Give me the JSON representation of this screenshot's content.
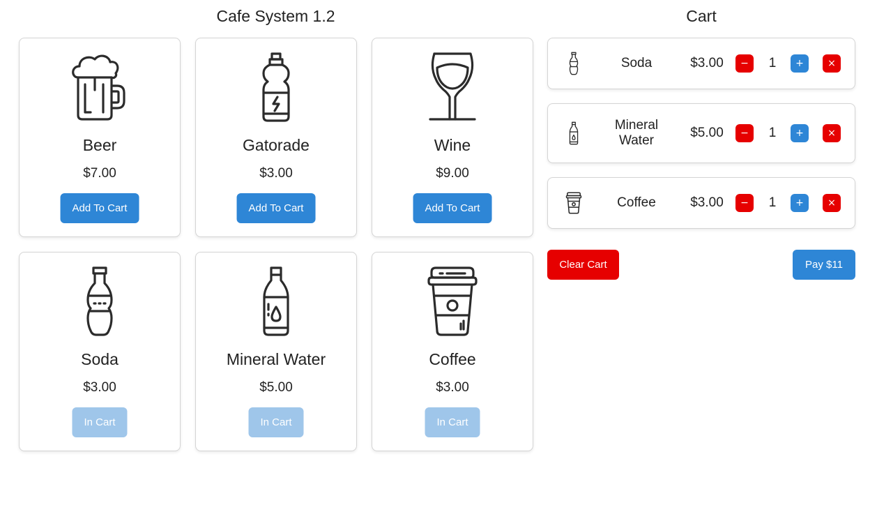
{
  "header": {
    "title": "Cafe System 1.2",
    "cart_title": "Cart"
  },
  "products": [
    {
      "name": "Beer",
      "price": "$7.00",
      "button": "Add To Cart",
      "icon": "beer-mug-icon",
      "in_cart": false
    },
    {
      "name": "Gatorade",
      "price": "$3.00",
      "button": "Add To Cart",
      "icon": "sports-bottle-icon",
      "in_cart": false
    },
    {
      "name": "Wine",
      "price": "$9.00",
      "button": "Add To Cart",
      "icon": "wine-glass-icon",
      "in_cart": false
    },
    {
      "name": "Soda",
      "price": "$3.00",
      "button": "In Cart",
      "icon": "soda-bottle-icon",
      "in_cart": true
    },
    {
      "name": "Mineral Water",
      "price": "$5.00",
      "button": "In Cart",
      "icon": "water-bottle-icon",
      "in_cart": true
    },
    {
      "name": "Coffee",
      "price": "$3.00",
      "button": "In Cart",
      "icon": "coffee-cup-icon",
      "in_cart": true
    }
  ],
  "cart": {
    "items": [
      {
        "name": "Soda",
        "price": "$3.00",
        "qty": "1",
        "icon": "soda-bottle-icon",
        "minus": "−",
        "plus": "+",
        "remove": "×"
      },
      {
        "name": "Mineral Water",
        "price": "$5.00",
        "qty": "1",
        "icon": "water-bottle-icon",
        "minus": "−",
        "plus": "+",
        "remove": "×"
      },
      {
        "name": "Coffee",
        "price": "$3.00",
        "qty": "1",
        "icon": "coffee-cup-icon",
        "minus": "−",
        "plus": "+",
        "remove": "×"
      }
    ],
    "clear_label": "Clear Cart",
    "pay_label": "Pay $11"
  },
  "colors": {
    "primary": "#2e86d6",
    "primary_disabled": "#9fc6ea",
    "danger": "#e60000",
    "icon_stroke": "#2b2b2b"
  }
}
